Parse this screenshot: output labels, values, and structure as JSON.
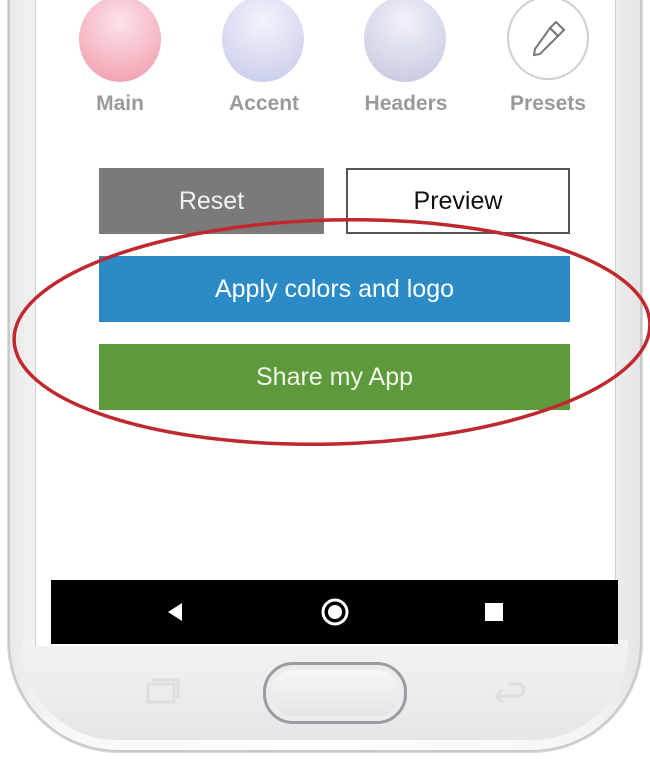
{
  "colors": {
    "main": "#f3a9b8",
    "accent": "#d4d7ef",
    "headers": "#d2d3e6",
    "reset_button": "#7a7a7a",
    "apply_button": "#2a8bc6",
    "share_button": "#5e9a3b",
    "highlight_ellipse": "#c0282f"
  },
  "swatches": [
    {
      "label": "Main",
      "icon": "pink-swatch-icon"
    },
    {
      "label": "Accent",
      "icon": "lavender-swatch-icon"
    },
    {
      "label": "Headers",
      "icon": "light-purple-swatch-icon"
    },
    {
      "label": "Presets",
      "icon": "eyedropper-icon"
    }
  ],
  "buttons": {
    "reset": "Reset",
    "preview": "Preview",
    "apply": "Apply colors and logo",
    "share": "Share my App"
  },
  "android_nav": {
    "back": "back-triangle-icon",
    "home": "home-circle-icon",
    "recents": "recents-square-icon"
  },
  "hardware_keys": {
    "recent_apps": "recent-apps-icon",
    "home": "physical-home-button",
    "back": "back-arrow-icon"
  }
}
